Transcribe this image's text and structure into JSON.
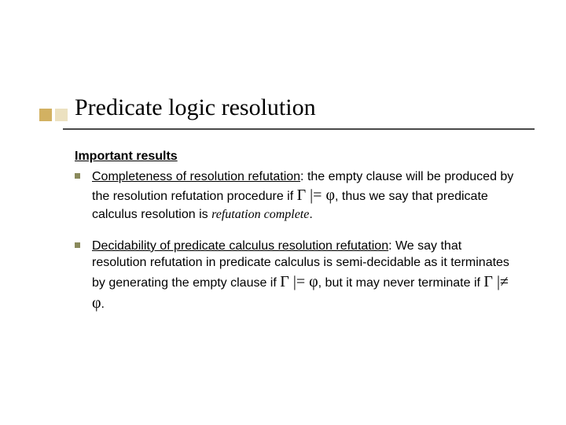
{
  "title": "Predicate logic resolution",
  "subheading": "Important results",
  "bullets": [
    {
      "lead_u": "Completeness of resolution refutation",
      "after_lead": ": the empty clause will be produced by the resolution refutation procedure if ",
      "sym1": "Γ",
      "rel1": " |= ",
      "sym2": "φ",
      "after_rel": ", thus we say that predicate calculus resolution is ",
      "ital": "refutation complete",
      "tail": "."
    },
    {
      "lead_u": "Decidability of predicate calculus resolution refutation",
      "after_lead": ": We say that resolution refutation in predicate calculus is semi-decidable as it terminates by generating the empty clause if  ",
      "sym1": "Γ",
      "rel1": " |= ",
      "sym2": "φ",
      "mid": ", but it may never terminate if ",
      "sym3": "Γ",
      "rel2": " |≠ ",
      "sym4": "φ",
      "tail": "."
    }
  ]
}
